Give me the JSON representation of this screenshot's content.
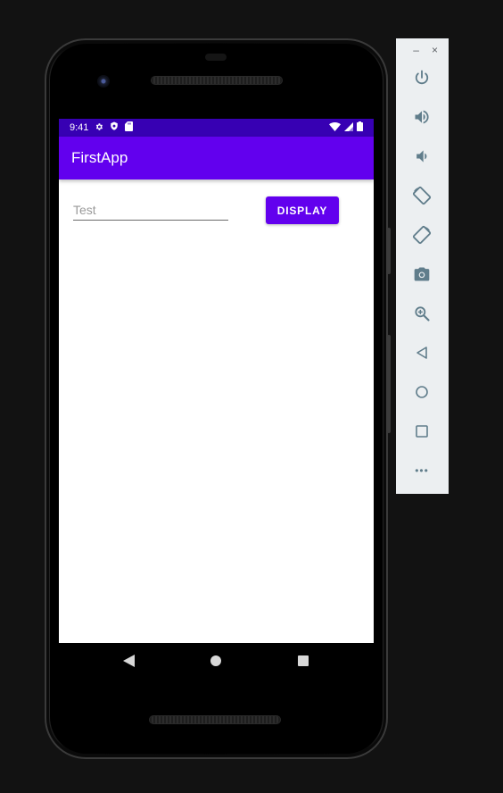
{
  "status_bar": {
    "time": "9:41"
  },
  "app_bar": {
    "title": "FirstApp"
  },
  "main": {
    "input_placeholder": "Test",
    "input_value": "",
    "display_button_label": "DISPLAY"
  },
  "emulator_toolbar": {
    "window_controls": {
      "minimize": "–",
      "close": "×"
    },
    "tools": [
      "power-icon",
      "volume-up-icon",
      "volume-down-icon",
      "rotate-left-icon",
      "rotate-right-icon",
      "camera-icon",
      "zoom-icon",
      "back-icon",
      "home-icon",
      "overview-icon",
      "more-icon"
    ],
    "more_label": "•••"
  },
  "colors": {
    "primary": "#6200ee",
    "primary_dark": "#3700b3",
    "toolbar_bg": "#eceff1",
    "toolbar_icon": "#607d8b"
  }
}
